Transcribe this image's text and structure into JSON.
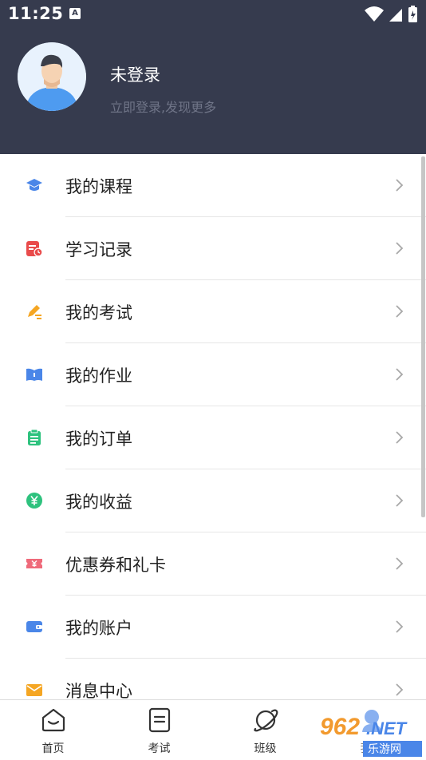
{
  "status_bar": {
    "time": "11:25",
    "badge": "A"
  },
  "profile": {
    "name": "未登录",
    "subtitle": "立即登录,发现更多"
  },
  "menu": [
    {
      "label": "我的课程",
      "icon": "graduation-cap-icon",
      "color": "#4a86e8"
    },
    {
      "label": "学习记录",
      "icon": "study-record-icon",
      "color": "#e94b4b"
    },
    {
      "label": "我的考试",
      "icon": "pencil-exam-icon",
      "color": "#f5a623"
    },
    {
      "label": "我的作业",
      "icon": "book-icon",
      "color": "#4a86e8"
    },
    {
      "label": "我的订单",
      "icon": "clipboard-icon",
      "color": "#2ec27e"
    },
    {
      "label": "我的收益",
      "icon": "yen-coin-icon",
      "color": "#2ec27e"
    },
    {
      "label": "优惠券和礼卡",
      "icon": "coupon-icon",
      "color": "#ef6a7a"
    },
    {
      "label": "我的账户",
      "icon": "wallet-icon",
      "color": "#4a86e8"
    },
    {
      "label": "消息中心",
      "icon": "envelope-icon",
      "color": "#f5a623"
    }
  ],
  "tabs": [
    {
      "label": "首页",
      "icon": "home-icon"
    },
    {
      "label": "考试",
      "icon": "exam-icon"
    },
    {
      "label": "班级",
      "icon": "planet-icon"
    },
    {
      "label": "我的",
      "icon": "profile-icon"
    }
  ],
  "watermark": {
    "text": "962.NET",
    "subtext": "乐游网"
  }
}
